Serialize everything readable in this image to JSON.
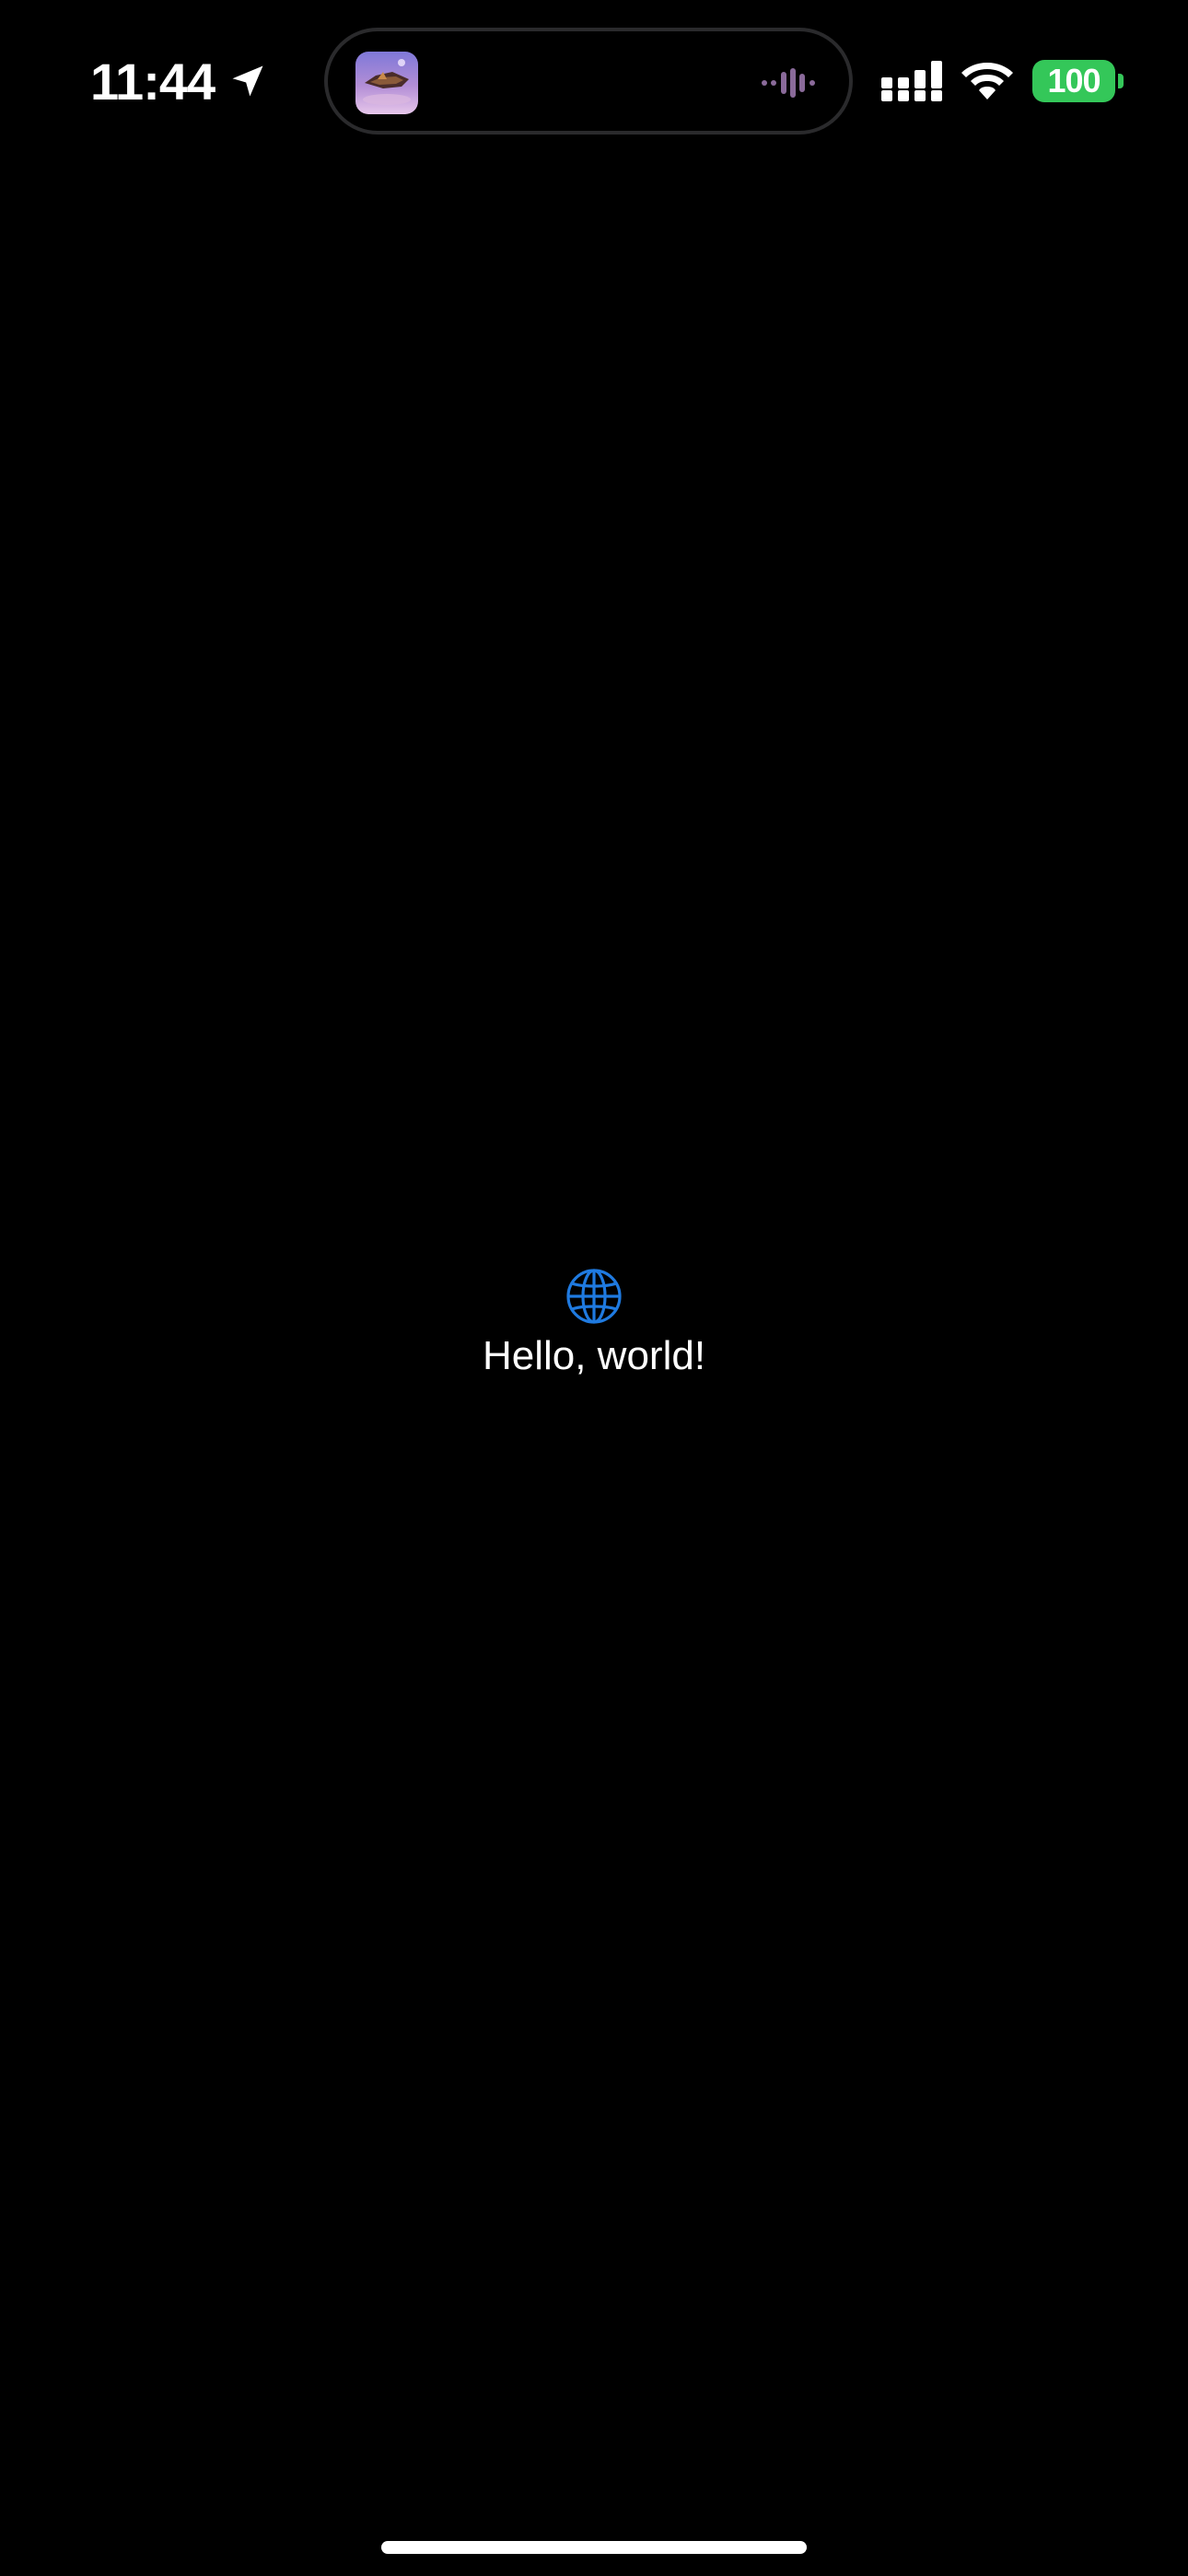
{
  "status_bar": {
    "time": "11:44",
    "battery_level": "100",
    "location_icon": "location-arrow-icon",
    "cellular_icon": "cellular-signal-icon",
    "wifi_icon": "wifi-icon"
  },
  "dynamic_island": {
    "artwork_icon": "album-artwork-icon",
    "activity_icon": "audio-waveform-icon",
    "waveform_color": "#8a6a9a"
  },
  "content": {
    "icon": "globe-icon",
    "icon_color": "#1f7ae0",
    "text": "Hello, world!"
  },
  "colors": {
    "background": "#000000",
    "battery": "#34c759",
    "text": "#ffffff"
  }
}
